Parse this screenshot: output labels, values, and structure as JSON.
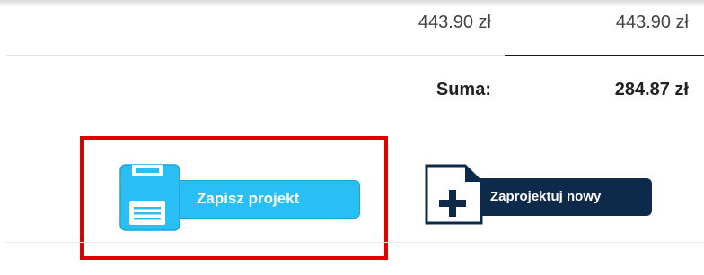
{
  "prices": {
    "unit_price": "443.90 zł",
    "total_price": "443.90 zł"
  },
  "summary": {
    "label": "Suma:",
    "value": "284.87 zł"
  },
  "actions": {
    "save_label": "Zapisz projekt",
    "new_label": "Zaprojektuj nowy"
  },
  "colors": {
    "save_accent": "#29bff5",
    "new_accent": "#0e2a4a",
    "highlight": "#e00000"
  },
  "icons": {
    "save": "floppy-disk-icon",
    "new": "new-document-plus-icon"
  }
}
